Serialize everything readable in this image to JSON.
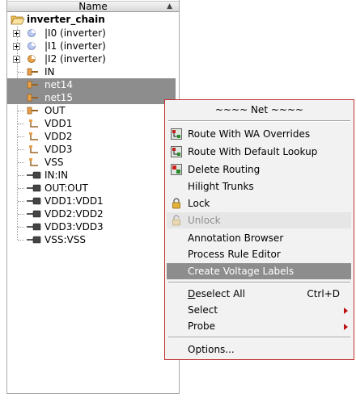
{
  "tree": {
    "column_header": "Name",
    "sort_indicator": "▲",
    "root": "inverter_chain",
    "items": [
      {
        "label": "|I0 (inverter)"
      },
      {
        "label": "|I1 (inverter)"
      },
      {
        "label": "|I2 (inverter)"
      },
      {
        "label": "IN"
      },
      {
        "label": "net14"
      },
      {
        "label": "net15"
      },
      {
        "label": "OUT"
      },
      {
        "label": "VDD1"
      },
      {
        "label": "VDD2"
      },
      {
        "label": "VDD3"
      },
      {
        "label": "VSS"
      },
      {
        "label": "IN:IN"
      },
      {
        "label": "OUT:OUT"
      },
      {
        "label": "VDD1:VDD1"
      },
      {
        "label": "VDD2:VDD2"
      },
      {
        "label": "VDD3:VDD3"
      },
      {
        "label": "VSS:VSS"
      }
    ]
  },
  "menu": {
    "title": "~~~~ Net ~~~~",
    "items": [
      {
        "label": "Route With WA Overrides"
      },
      {
        "label": "Route With Default Lookup"
      },
      {
        "label": "Delete Routing"
      },
      {
        "label": "Hilight Trunks"
      },
      {
        "label": "Lock"
      },
      {
        "label": "Unlock"
      },
      {
        "label": "Annotation Browser"
      },
      {
        "label": "Process Rule Editor"
      },
      {
        "label": "Create Voltage Labels"
      },
      {
        "label_first": "D",
        "label_rest": "eselect All",
        "shortcut": "Ctrl+D"
      },
      {
        "label": "Select"
      },
      {
        "label": "Probe"
      },
      {
        "label": "Options..."
      }
    ]
  },
  "colors": {
    "selection": "#8d8d8d",
    "menu_border": "#c03030",
    "submenu_arrow": "#c01010"
  }
}
